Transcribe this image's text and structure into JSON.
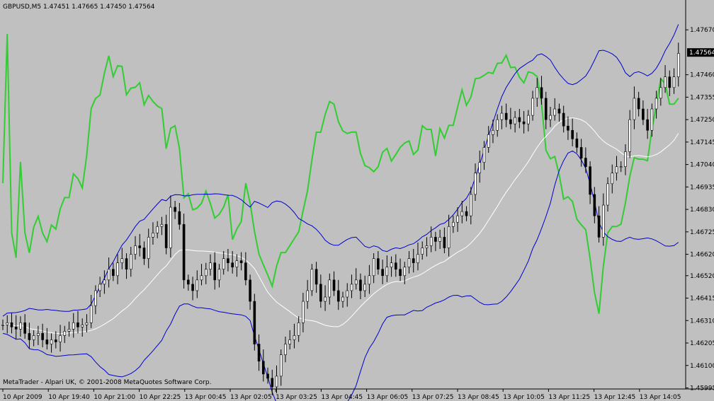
{
  "chart_data": {
    "type": "line",
    "header": "GBPUSD,M5  1.47451 1.47665 1.47450 1.47564",
    "footer": "MetaTrader - Alpari UK, © 2001-2008 MetaQuotes Software Corp.",
    "current_price": "1.47564",
    "price_axis": {
      "ylim": [
        1.4599,
        1.4775
      ],
      "ticks": [
        "1.47670",
        "1.47460",
        "1.47355",
        "1.47250",
        "1.47145",
        "1.47040",
        "1.46935",
        "1.46830",
        "1.46725",
        "1.46620",
        "1.46520",
        "1.46415",
        "1.46310",
        "1.46205",
        "1.46100",
        "1.45995"
      ],
      "tick_values": [
        1.4767,
        1.4746,
        1.47355,
        1.4725,
        1.47145,
        1.4704,
        1.46935,
        1.4683,
        1.46725,
        1.4662,
        1.4652,
        1.46415,
        1.4631,
        1.46205,
        1.461,
        1.45995
      ]
    },
    "time_axis": {
      "labels": [
        "10 Apr 2009",
        "10 Apr 19:40",
        "10 Apr 21:00",
        "10 Apr 22:25",
        "13 Apr 00:45",
        "13 Apr 02:05",
        "13 Apr 03:25",
        "13 Apr 04:45",
        "13 Apr 06:05",
        "13 Apr 07:25",
        "13 Apr 08:45",
        "13 Apr 10:05",
        "13 Apr 11:25",
        "13 Apr 12:45",
        "13 Apr 14:05"
      ]
    },
    "bar_count": 150,
    "close": [
      1.4629,
      1.463,
      1.4628,
      1.4627,
      1.463,
      1.4625,
      1.4622,
      1.4624,
      1.4625,
      1.4622,
      1.462,
      1.4622,
      1.4621,
      1.4624,
      1.4626,
      1.4627,
      1.463,
      1.4628,
      1.4629,
      1.463,
      1.4638,
      1.4645,
      1.4648,
      1.465,
      1.4655,
      1.4652,
      1.4658,
      1.466,
      1.4655,
      1.4662,
      1.4666,
      1.4665,
      1.466,
      1.467,
      1.4672,
      1.4675,
      1.4676,
      1.4665,
      1.4684,
      1.4682,
      1.4676,
      1.465,
      1.4648,
      1.4645,
      1.465,
      1.4652,
      1.4655,
      1.4658,
      1.465,
      1.4655,
      1.466,
      1.4658,
      1.4656,
      1.4659,
      1.4658,
      1.465,
      1.464,
      1.462,
      1.4612,
      1.4606,
      1.4604,
      1.46,
      1.4605,
      1.4615,
      1.462,
      1.4622,
      1.4624,
      1.463,
      1.464,
      1.4645,
      1.4655,
      1.4648,
      1.464,
      1.4642,
      1.465,
      1.4645,
      1.464,
      1.4642,
      1.4645,
      1.4648,
      1.465,
      1.4645,
      1.4648,
      1.4652,
      1.466,
      1.4655,
      1.4652,
      1.4656,
      1.4658,
      1.4655,
      1.4652,
      1.4656,
      1.466,
      1.4658,
      1.4662,
      1.4665,
      1.4666,
      1.467,
      1.4668,
      1.467,
      1.4665,
      1.4675,
      1.4677,
      1.468,
      1.4682,
      1.468,
      1.469,
      1.47,
      1.4705,
      1.4712,
      1.4718,
      1.472,
      1.4725,
      1.4728,
      1.4725,
      1.4723,
      1.4726,
      1.4724,
      1.4723,
      1.4727,
      1.4735,
      1.474,
      1.4735,
      1.4725,
      1.4727,
      1.473,
      1.4728,
      1.4722,
      1.472,
      1.4716,
      1.4712,
      1.4707,
      1.4703,
      1.469,
      1.468,
      1.467,
      1.4685,
      1.4695,
      1.47,
      1.4703,
      1.4703,
      1.471,
      1.4725,
      1.4735,
      1.473,
      1.4725,
      1.472,
      1.473,
      1.4735,
      1.474,
      1.4745,
      1.474,
      1.4745,
      1.4756
    ],
    "rsi_overlay_note": "",
    "indicator_series": [
      {
        "color": "#32cd32"
      },
      {
        "color": "#0000cd"
      },
      {
        "color": "#ffffff"
      }
    ]
  },
  "colors": {
    "background": "#c0c0c0",
    "bar": "#000000",
    "rsi": "#32cd32",
    "bands": "#0000cd",
    "ma": "#ffffff",
    "price_box": "#000000",
    "price_box_text": "#ffffff"
  }
}
